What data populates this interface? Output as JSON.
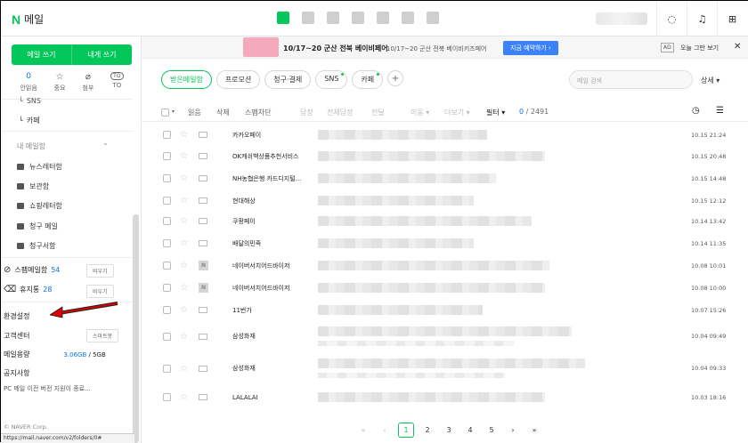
{
  "header": {
    "logo_n": "N",
    "logo_title": "메일",
    "apps": [
      "mail-icon",
      "calendar-icon",
      "photo-icon",
      "contacts-icon",
      "drive-icon",
      "memo-icon",
      "bookmark-icon"
    ]
  },
  "sidebar": {
    "write_label": "메일 쓰기",
    "self_write_label": "내게 쓰기",
    "quick": [
      {
        "top": "0",
        "label": "안읽음",
        "icon": null
      },
      {
        "top": "☆",
        "label": "중요",
        "icon": "star-icon"
      },
      {
        "top": "⌕",
        "label": "첨부",
        "icon": "attach-icon"
      },
      {
        "top": "TO",
        "label": "TO",
        "icon": "to-icon"
      }
    ],
    "sub_items": [
      "SNS",
      "카페"
    ],
    "my_mail_label": "내 메일함",
    "folders": [
      "뉴스레터함",
      "보관함",
      "쇼핑레터함",
      "청구 메일",
      "청구서함"
    ],
    "spam_label": "스팸메일함",
    "spam_count": "54",
    "empty_label": "비우기",
    "trash_label": "휴지통",
    "trash_count": "28",
    "settings_label": "환경설정",
    "support_label": "고객센터",
    "smartbot_label": "스마트봇",
    "capacity_label": "메일용량",
    "capacity_used": "3.06GB",
    "capacity_total": " / 5GB",
    "notice_label": "공지사항",
    "notice_text": "PC 메일 이전 버전 지원이 종료...",
    "copyright": "© NAVER Corp.",
    "status_url": "https://mail.naver.com/v2/folders/0#"
  },
  "ad": {
    "title": "10/17~20 군산 전북 베이비페어",
    "sub": "10/17~20 군산 전북 베이비키즈페어",
    "cta": "지금 예약하기 ›",
    "tag": "AD",
    "close": "오늘 그만 보기",
    "x": "✕"
  },
  "tabs": [
    {
      "label": "받은메일함",
      "active": true
    },
    {
      "label": "프로모션"
    },
    {
      "label": "청구·결제"
    },
    {
      "label": "SNS",
      "dot": true
    },
    {
      "label": "카페",
      "dot": true
    }
  ],
  "search": {
    "placeholder": "메일 검색",
    "detail": "상세 ▾"
  },
  "toolbar": {
    "read": "읽음",
    "delete": "삭제",
    "spam": "스팸차단",
    "reply": "답장",
    "reply_all": "전체답장",
    "forward": "전달",
    "move": "이동 ▾",
    "more": "더보기 ▾",
    "filter": "필터 ▾",
    "count_current": "0",
    "count_total": " / 2491"
  },
  "mails": [
    {
      "sender": "카카오페이",
      "date": "10.15 21:24"
    },
    {
      "sender": "OK캐쉬백상품추천서비스",
      "date": "10.15 20:48"
    },
    {
      "sender": "NH농협은행 카드디지털...",
      "date": "10.15 14:48"
    },
    {
      "sender": "현대해상",
      "date": "10.15 12:12"
    },
    {
      "sender": "쿠팡페이",
      "date": "10.14 13:42"
    },
    {
      "sender": "배달의민족",
      "date": "10.14 11:35"
    },
    {
      "sender": "네이버서치어드바이저",
      "date": "10.08 10:01",
      "badge": "N"
    },
    {
      "sender": "네이버서치어드바이저",
      "date": "10.08 10:00",
      "badge": "N"
    },
    {
      "sender": "11번가",
      "date": "10.07 15:26"
    },
    {
      "sender": "삼성화재",
      "date": "10.04 09:49"
    },
    {
      "sender": "삼성화재",
      "date": "10.04 09:33"
    },
    {
      "sender": "LALALAI",
      "date": "10.03 18:16"
    }
  ],
  "pager": {
    "pages": [
      "1",
      "2",
      "3",
      "4",
      "5"
    ],
    "first": "«",
    "prev": "‹",
    "next": "›",
    "last": "»"
  }
}
